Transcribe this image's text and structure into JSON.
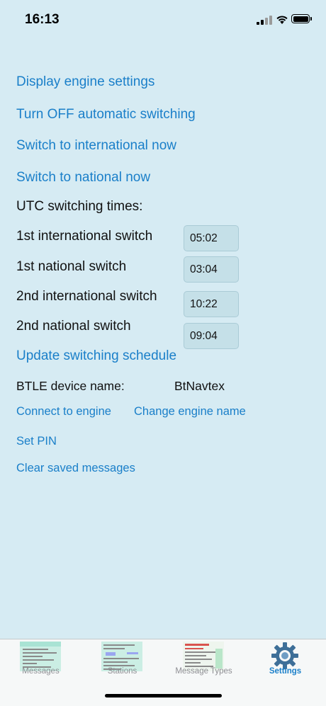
{
  "status_bar": {
    "time": "16:13"
  },
  "settings": {
    "display_engine_settings": "Display engine settings",
    "turn_off_auto": "Turn OFF automatic switching",
    "switch_international": "Switch to international now",
    "switch_national": "Switch to national now",
    "utc_heading": "UTC switching times:",
    "switches": [
      {
        "label": "1st international switch",
        "value": "05:02"
      },
      {
        "label": "1st national switch",
        "value": "03:04"
      },
      {
        "label": "2nd international switch",
        "value": "10:22"
      },
      {
        "label": "2nd national switch",
        "value": "09:04"
      }
    ],
    "update_schedule": "Update switching schedule",
    "btle_label": "BTLE device name:",
    "btle_name": "BtNavtex",
    "connect_engine": "Connect to engine",
    "change_engine_name": "Change engine name",
    "set_pin": "Set PIN",
    "clear_messages": "Clear saved messages"
  },
  "tabs": [
    {
      "label": "Messages",
      "icon": "messages-thumbnail-icon"
    },
    {
      "label": "Stations",
      "icon": "stations-thumbnail-icon"
    },
    {
      "label": "Message Types",
      "icon": "message-types-thumbnail-icon"
    },
    {
      "label": "Settings",
      "icon": "gear-icon",
      "active": true
    }
  ],
  "colors": {
    "accent": "#1a7fc9",
    "background": "#d6ebf3",
    "field": "#c5e0e8"
  }
}
